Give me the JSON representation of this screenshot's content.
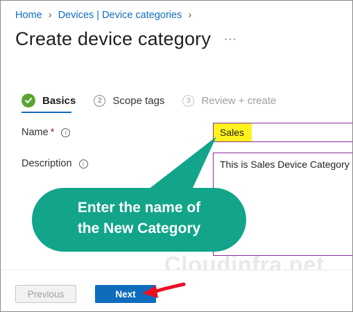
{
  "breadcrumb": {
    "items": [
      "Home",
      "Devices | Device categories"
    ]
  },
  "page": {
    "title": "Create device category",
    "more_label": "···"
  },
  "wizard": {
    "steps": [
      {
        "number": "",
        "label": "Basics",
        "state": "completed"
      },
      {
        "number": "2",
        "label": "Scope tags",
        "state": "available"
      },
      {
        "number": "3",
        "label": "Review + create",
        "state": "disabled"
      }
    ]
  },
  "form": {
    "name": {
      "label": "Name",
      "required_mark": "*",
      "value": "Sales"
    },
    "description": {
      "label": "Description",
      "value": "This is Sales Device Category"
    }
  },
  "annotation": {
    "callout_text": "Enter the name of\nthe New Category"
  },
  "watermark": "Cloudinfra.net",
  "footer": {
    "previous_label": "Previous",
    "next_label": "Next"
  },
  "colors": {
    "accent": "#0f6cbd",
    "success": "#5ca332",
    "callout": "#12a58a",
    "highlight": "#fff21e",
    "arrow": "#e81123",
    "field_border": "#8a2d9a"
  }
}
